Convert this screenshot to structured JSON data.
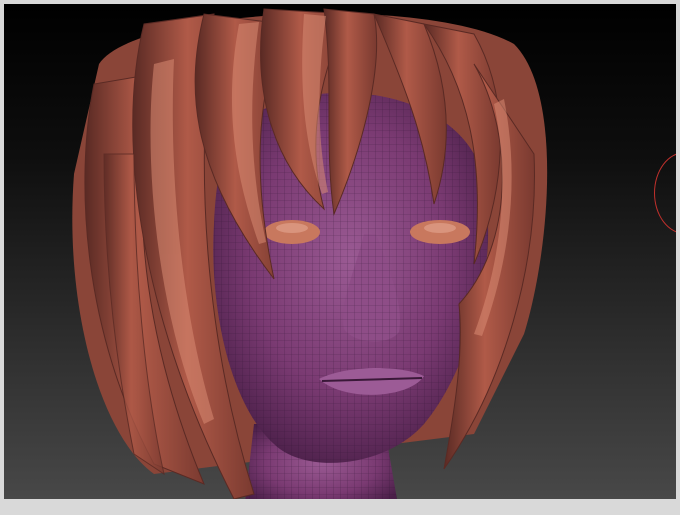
{
  "viewport": {
    "background_top": "#000000",
    "background_bottom": "#4a4a4a",
    "frame_color": "#d9d9d9"
  },
  "model": {
    "skin_color": "#7a3a72",
    "hair_color": "#b05a48",
    "hair_highlight": "#d88a72",
    "eye_color": "#c8785e",
    "wireframe_color": "#2a1230"
  },
  "gizmo": {
    "icon": "rotation-gizmo-icon",
    "color": "#c0302c"
  }
}
